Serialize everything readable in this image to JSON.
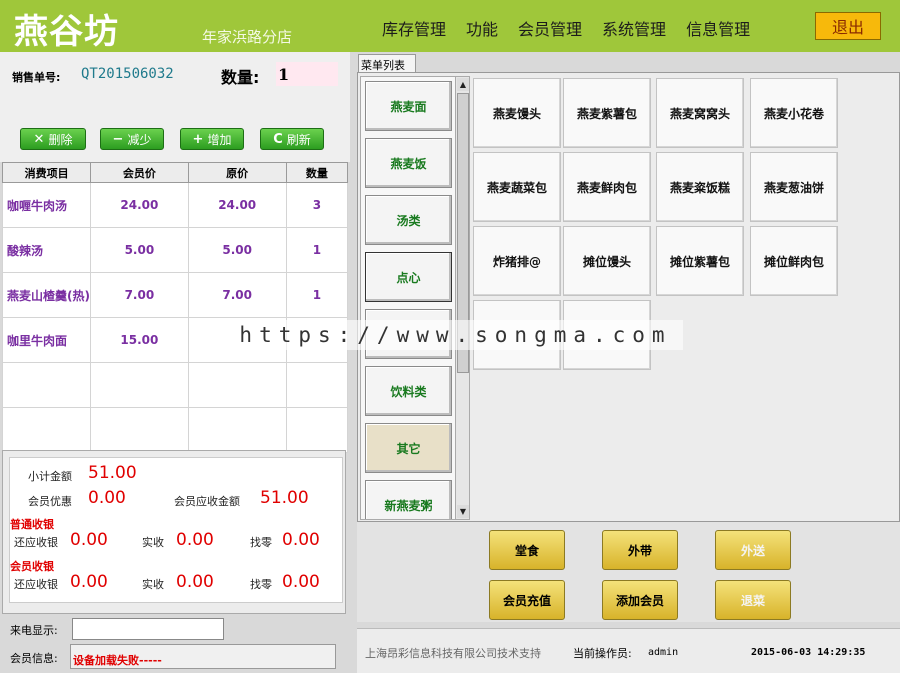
{
  "header": {
    "brand": "燕谷坊",
    "branch": "年家浜路分店",
    "nav": [
      "库存管理",
      "功能",
      "会员管理",
      "系统管理",
      "信息管理"
    ],
    "exit_label": "退出"
  },
  "order": {
    "order_no_label": "销售单号:",
    "order_no": "QT201506032",
    "qty_label": "数量:",
    "qty_value": "1"
  },
  "actions": {
    "delete": "删除",
    "delete_icon": "✕",
    "decrease": "减少",
    "decrease_icon": "−",
    "increase": "增加",
    "increase_icon": "+",
    "refresh": "刷新",
    "refresh_icon": "C"
  },
  "table": {
    "headers": [
      "消费项目",
      "会员价",
      "原价",
      "数量"
    ],
    "rows": [
      {
        "item": "咖喱牛肉汤",
        "member_price": "24.00",
        "price": "24.00",
        "qty": "3"
      },
      {
        "item": "酸辣汤",
        "member_price": "5.00",
        "price": "5.00",
        "qty": "1"
      },
      {
        "item": "燕麦山楂羹(热)",
        "member_price": "7.00",
        "price": "7.00",
        "qty": "1"
      },
      {
        "item": "咖里牛肉面",
        "member_price": "15.00",
        "price": "",
        "qty": ""
      }
    ]
  },
  "totals": {
    "subtotal_label": "小计金额",
    "subtotal": "51.00",
    "discount_label": "会员优惠",
    "discount": "0.00",
    "member_due_label": "会员应收金额",
    "member_due": "51.00",
    "normal_section": "普通收银",
    "member_section": "会员收银",
    "due_label": "还应收银",
    "received_label": "实收",
    "change_label": "找零",
    "normal_due": "0.00",
    "normal_received": "0.00",
    "normal_change": "0.00",
    "member_due2": "0.00",
    "member_received": "0.00",
    "member_change": "0.00"
  },
  "caller": {
    "label": "来电显示:",
    "value": ""
  },
  "member": {
    "label": "会员信息:",
    "status": "设备加载失败-----"
  },
  "menu": {
    "tab_label": "菜单列表",
    "scroll_up_icon": "▲",
    "scroll_down_icon": "▼",
    "categories": [
      "燕麦面",
      "燕麦饭",
      "汤类",
      "点心",
      "",
      "饮料类",
      "其它",
      "新燕麦粥"
    ],
    "dishes": [
      "燕麦馒头",
      "燕麦紫薯包",
      "燕麦窝窝头",
      "燕麦小花卷",
      "燕麦蔬菜包",
      "燕麦鲜肉包",
      "燕麦粢饭糕",
      "燕麦葱油饼",
      "炸猪排@",
      "摊位馒头",
      "摊位紫薯包",
      "摊位鲜肉包",
      "",
      ""
    ]
  },
  "order_types": [
    "堂食",
    "外带",
    "外送",
    "会员充值",
    "添加会员",
    "退菜"
  ],
  "status": {
    "company": "上海昂彩信息科技有限公司技术支持",
    "operator_label": "当前操作员:",
    "operator": "admin",
    "datetime": "2015-06-03 14:29:35"
  },
  "watermark": "https://www.songma.com",
  "colors": {
    "header_green": "#9fc73a",
    "accent_red": "#e00000",
    "category_green": "#197a1f",
    "gold_button": "#e8c84a"
  }
}
